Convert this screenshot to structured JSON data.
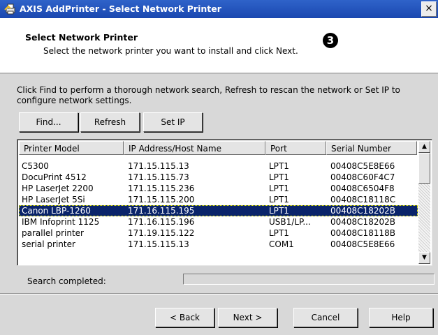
{
  "window": {
    "title": "AXIS AddPrinter - Select Network Printer",
    "close_label": "×"
  },
  "header": {
    "title": "Select Network Printer",
    "subtitle": "Select the network printer you want to install and click Next.",
    "step_marker": "3"
  },
  "instructions": "Click Find to perform a thorough network search, Refresh to rescan the network or Set IP to configure network settings.",
  "toolbar": {
    "find_label": "Find...",
    "refresh_label": "Refresh",
    "setip_label": "Set IP"
  },
  "table": {
    "columns": [
      "Printer Model",
      "IP Address/Host Name",
      "Port",
      "Serial Number"
    ],
    "rows": [
      {
        "model": "C5300",
        "ip": "171.15.115.13",
        "port": "LPT1",
        "serial": "00408C5E8E66"
      },
      {
        "model": "DocuPrint 4512",
        "ip": "171.15.115.73",
        "port": "LPT1",
        "serial": "00408C60F4C7"
      },
      {
        "model": "HP LaserJet 2200",
        "ip": "171.15.115.236",
        "port": "LPT1",
        "serial": "00408C6504F8"
      },
      {
        "model": "HP LaserJet 5Si",
        "ip": "171.15.115.200",
        "port": "LPT1",
        "serial": "00408C18118C"
      },
      {
        "model": "Canon LBP-1260",
        "ip": "171.16.115.195",
        "port": "LPT1",
        "serial": "00408C18202B"
      },
      {
        "model": "IBM Infoprint 1125",
        "ip": "171.16.115.196",
        "port": "USB1/LP...",
        "serial": "00408C18202B"
      },
      {
        "model": "parallel printer",
        "ip": "171.19.115.122",
        "port": "LPT1",
        "serial": "00408C18118B"
      },
      {
        "model": "serial printer",
        "ip": "171.15.115.13",
        "port": "COM1",
        "serial": "00408C5E8E66"
      }
    ],
    "selected_index": 4
  },
  "status": {
    "text": "Search completed:"
  },
  "footer": {
    "back_label": "< Back",
    "next_label": "Next >",
    "cancel_label": "Cancel",
    "help_label": "Help"
  },
  "colors": {
    "titlebar": "#1a47b0",
    "selection": "#0a246a",
    "dialog_bg": "#d8d8d8"
  }
}
